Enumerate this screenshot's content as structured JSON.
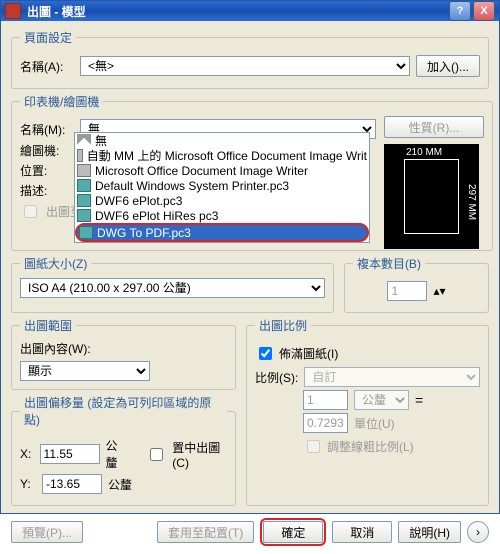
{
  "title": "出圖 - 模型",
  "help_glyph": "?",
  "close_glyph": "X",
  "page_setup": {
    "legend": "頁面設定",
    "name_label": "名稱(A):",
    "name_value": "<無>",
    "add_btn": "加入()..."
  },
  "printer": {
    "legend": "印表機/繪圖機",
    "name_label": "名稱(M):",
    "name_value": "無",
    "plotter_label": "繪圖機:",
    "location_label": "位置:",
    "desc_label": "描述:",
    "to_file_label": "出圖至",
    "props_btn": "性質(R)...",
    "options": [
      "無",
      "自動 MM 上的 Microsoft Office Document Image Writ",
      "Microsoft Office Document Image Writer",
      "Default Windows System Printer.pc3",
      "DWF6 ePlot.pc3",
      "DWF6 ePlot HiRes pc3",
      "DWG To PDF.pc3"
    ],
    "preview_w": "210 MM",
    "preview_h": "297 MM"
  },
  "paper": {
    "legend": "圖紙大小(Z)",
    "value": "ISO A4 (210.00 x 297.00 公釐)"
  },
  "copies": {
    "legend": "複本數目(B)",
    "value": "1"
  },
  "area": {
    "legend": "出圖範圍",
    "what_label": "出圖內容(W):",
    "what_value": "顯示"
  },
  "scale": {
    "legend": "出圖比例",
    "fit_label": "佈滿圖紙(I)",
    "ratio_label": "比例(S):",
    "ratio_value": "自訂",
    "num": "1",
    "unit": "公釐",
    "den": "0.7293",
    "unit2": "單位(U)",
    "lw_label": "調整線粗比例(L)",
    "eq": "="
  },
  "offset": {
    "legend": "出圖偏移量 (設定為可列印區域的原點)",
    "x_label": "X:",
    "x_value": "11.55",
    "y_label": "Y:",
    "y_value": "-13.65",
    "unit": "公釐",
    "center_label": "置中出圖(C)"
  },
  "buttons": {
    "preview": "預覽(P)...",
    "apply": "套用至配置(T)",
    "ok": "確定",
    "cancel": "取消",
    "help": "說明(H)",
    "expand": "›"
  }
}
